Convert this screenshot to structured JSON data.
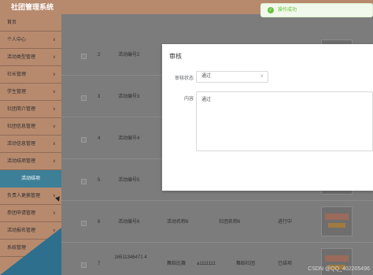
{
  "header": {
    "app_title": "社团管理系统"
  },
  "sidebar": {
    "items": [
      {
        "label": "首页",
        "has_chevron": false
      },
      {
        "label": "个人中心",
        "has_chevron": true
      },
      {
        "label": "活动类型管理",
        "has_chevron": true
      },
      {
        "label": "社长管理",
        "has_chevron": true
      },
      {
        "label": "学生管理",
        "has_chevron": true
      },
      {
        "label": "社团简介管理",
        "has_chevron": true
      },
      {
        "label": "社团信息管理",
        "has_chevron": true
      },
      {
        "label": "活动信息管理",
        "has_chevron": true
      },
      {
        "label": "活动结项管理",
        "has_chevron": true
      },
      {
        "label": "活动结项",
        "has_chevron": false,
        "sub": true
      },
      {
        "label": "负责人更换管理",
        "has_chevron": true
      },
      {
        "label": "参团申请管理",
        "has_chevron": true
      },
      {
        "label": "活动报名管理",
        "has_chevron": true
      },
      {
        "label": "系统管理",
        "has_chevron": true
      }
    ]
  },
  "table": {
    "rows": [
      {
        "index": "2",
        "name": "活动编号2",
        "extra": "",
        "col4": "",
        "col5": "",
        "status": ""
      },
      {
        "index": "3",
        "name": "活动编号3",
        "extra": "",
        "col4": "",
        "col5": "",
        "status": ""
      },
      {
        "index": "4",
        "name": "活动编号4",
        "extra": "",
        "col4": "",
        "col5": "",
        "status": ""
      },
      {
        "index": "5",
        "name": "活动编号5",
        "extra": "",
        "col4": "",
        "col5": "",
        "status": ""
      },
      {
        "index": "6",
        "name": "活动编号6",
        "extra": "活动名称6",
        "col4": "社团名称6",
        "col5": "",
        "status": "进行中"
      },
      {
        "index": "7",
        "name": "16511346471 4",
        "extra": "舞蹈比赛",
        "col4": "a1111111",
        "col5": "舞蹈社团",
        "status": "已结项"
      }
    ]
  },
  "modal": {
    "title": "审核",
    "status_label": "审核状态",
    "status_value": "通过",
    "content_label": "内容",
    "content_value": "通过"
  },
  "toast": {
    "message": "操作成功"
  },
  "watermark": "CSDN @QQ_402205496",
  "icons": {
    "chevron": "chevron-down-icon",
    "success": "check-circle-icon"
  }
}
